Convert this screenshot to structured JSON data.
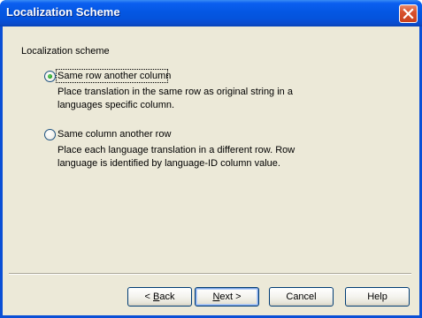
{
  "window": {
    "title": "Localization Scheme"
  },
  "group": {
    "label": "Localization scheme"
  },
  "options": [
    {
      "label": "Same row another column",
      "selected": true,
      "description_line1": "Place translation in the same row as original string in a",
      "description_line2": "languages specific column."
    },
    {
      "label": "Same column another row",
      "selected": false,
      "description_line1": "Place each language translation in a different row. Row",
      "description_line2": "language is identified by language-ID column value."
    }
  ],
  "buttons": {
    "back_prefix": "< ",
    "back_accel": "B",
    "back_rest": "ack",
    "next_accel": "N",
    "next_rest": "ext >",
    "cancel": "Cancel",
    "help": "Help"
  },
  "colors": {
    "titlebar": "#0453dc",
    "client_bg": "#ece9d8",
    "close_button": "#d8522e",
    "radio_selected_dot": "#21a121"
  },
  "icons": {
    "close": "close-x-icon"
  }
}
